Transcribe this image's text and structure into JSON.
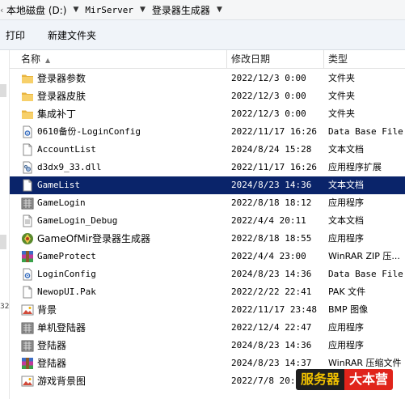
{
  "breadcrumb": [
    "本地磁盘 (D:)",
    "MirServer",
    "登录器生成器"
  ],
  "toolbar": {
    "print_label": "打印",
    "new_folder_label": "新建文件夹"
  },
  "columns": {
    "name": "名称",
    "modified": "修改日期",
    "type": "类型"
  },
  "left_pane_text": "32",
  "files": [
    {
      "name": "登录器参数",
      "modified": "2022/12/3 0:00",
      "type": "文件夹",
      "icon": "folder-icon"
    },
    {
      "name": "登录器皮肤",
      "modified": "2022/12/3 0:00",
      "type": "文件夹",
      "icon": "folder-icon"
    },
    {
      "name": "集成补丁",
      "modified": "2022/12/3 0:00",
      "type": "文件夹",
      "icon": "folder-icon"
    },
    {
      "name": "0610备份-LoginConfig",
      "modified": "2022/11/17 16:26",
      "type": "Data Base File",
      "icon": "config-file-icon"
    },
    {
      "name": "AccountList",
      "modified": "2024/8/24 15:28",
      "type": "文本文档",
      "icon": "text-file-icon"
    },
    {
      "name": "d3dx9_33.dll",
      "modified": "2022/11/17 16:26",
      "type": "应用程序扩展",
      "icon": "dll-file-icon"
    },
    {
      "name": "GameList",
      "modified": "2024/8/23 14:36",
      "type": "文本文档",
      "icon": "text-file-icon",
      "selected": true
    },
    {
      "name": "GameLogin",
      "modified": "2022/8/18 18:12",
      "type": "应用程序",
      "icon": "app-icon"
    },
    {
      "name": "GameLogin_Debug",
      "modified": "2022/4/4 20:11",
      "type": "文本文档",
      "icon": "text-file-icon"
    },
    {
      "name": "GameOfMir登录器生成器",
      "modified": "2022/8/18 18:55",
      "type": "应用程序",
      "icon": "generator-app-icon"
    },
    {
      "name": "GameProtect",
      "modified": "2022/4/4 23:00",
      "type": "WinRAR ZIP 压...",
      "icon": "winrar-icon"
    },
    {
      "name": "LoginConfig",
      "modified": "2024/8/23 14:36",
      "type": "Data Base File",
      "icon": "config-file-icon"
    },
    {
      "name": "NewopUI.Pak",
      "modified": "2022/2/22 22:41",
      "type": "PAK 文件",
      "icon": "blank-file-icon"
    },
    {
      "name": "背景",
      "modified": "2022/11/17 23:48",
      "type": "BMP 图像",
      "icon": "image-file-icon"
    },
    {
      "name": "单机登陆器",
      "modified": "2022/12/4 22:47",
      "type": "应用程序",
      "icon": "app-icon"
    },
    {
      "name": "登陆器",
      "modified": "2024/8/23 14:36",
      "type": "应用程序",
      "icon": "app-icon"
    },
    {
      "name": "登陆器",
      "modified": "2024/8/23 14:37",
      "type": "WinRAR 压缩文件",
      "icon": "winrar-icon"
    },
    {
      "name": "游戏背景图",
      "modified": "2022/7/8 20:37",
      "type": "",
      "icon": "image-file-icon"
    }
  ],
  "watermark": {
    "part1": "服务器",
    "part2": "大本营"
  }
}
